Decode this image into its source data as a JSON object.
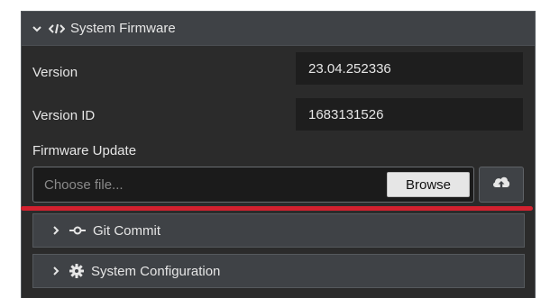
{
  "system_firmware": {
    "header": {
      "title": "System Firmware",
      "chevron_icon": "chevron-down-icon",
      "section_icon": "code-icon"
    },
    "version": {
      "label": "Version",
      "value": "23.04.252336"
    },
    "version_id": {
      "label": "Version ID",
      "value": "1683131526"
    },
    "firmware_update": {
      "label": "Firmware Update",
      "file_placeholder": "Choose file...",
      "browse_label": "Browse",
      "upload_icon": "cloud-upload-icon"
    }
  },
  "git_commit": {
    "title": "Git Commit",
    "chevron_icon": "chevron-right-icon",
    "section_icon": "git-commit-icon"
  },
  "system_configuration": {
    "title": "System Configuration",
    "chevron_icon": "chevron-right-icon",
    "section_icon": "gear-icon"
  },
  "colors": {
    "panel_bg": "#2b2b2b",
    "header_bg": "#3f4246",
    "value_bg": "#1e1e1e",
    "annotation_red": "#d3212f"
  }
}
